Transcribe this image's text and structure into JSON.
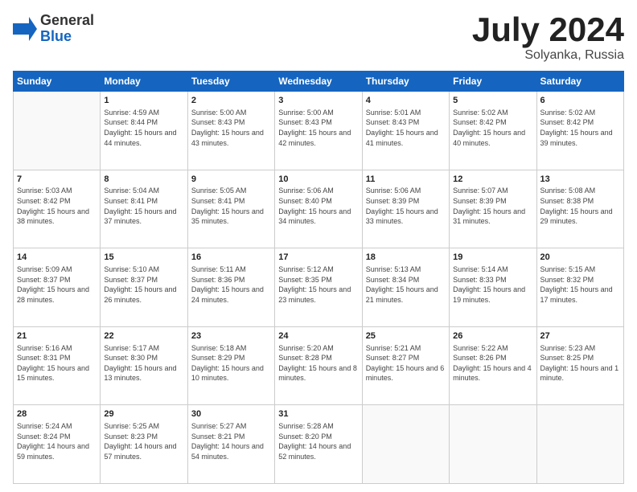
{
  "logo": {
    "general": "General",
    "blue": "Blue"
  },
  "title": {
    "month_year": "July 2024",
    "location": "Solyanka, Russia"
  },
  "weekdays": [
    "Sunday",
    "Monday",
    "Tuesday",
    "Wednesday",
    "Thursday",
    "Friday",
    "Saturday"
  ],
  "weeks": [
    [
      {
        "day": "",
        "sunrise": "",
        "sunset": "",
        "daylight": ""
      },
      {
        "day": "1",
        "sunrise": "Sunrise: 4:59 AM",
        "sunset": "Sunset: 8:44 PM",
        "daylight": "Daylight: 15 hours and 44 minutes."
      },
      {
        "day": "2",
        "sunrise": "Sunrise: 5:00 AM",
        "sunset": "Sunset: 8:43 PM",
        "daylight": "Daylight: 15 hours and 43 minutes."
      },
      {
        "day": "3",
        "sunrise": "Sunrise: 5:00 AM",
        "sunset": "Sunset: 8:43 PM",
        "daylight": "Daylight: 15 hours and 42 minutes."
      },
      {
        "day": "4",
        "sunrise": "Sunrise: 5:01 AM",
        "sunset": "Sunset: 8:43 PM",
        "daylight": "Daylight: 15 hours and 41 minutes."
      },
      {
        "day": "5",
        "sunrise": "Sunrise: 5:02 AM",
        "sunset": "Sunset: 8:42 PM",
        "daylight": "Daylight: 15 hours and 40 minutes."
      },
      {
        "day": "6",
        "sunrise": "Sunrise: 5:02 AM",
        "sunset": "Sunset: 8:42 PM",
        "daylight": "Daylight: 15 hours and 39 minutes."
      }
    ],
    [
      {
        "day": "7",
        "sunrise": "Sunrise: 5:03 AM",
        "sunset": "Sunset: 8:42 PM",
        "daylight": "Daylight: 15 hours and 38 minutes."
      },
      {
        "day": "8",
        "sunrise": "Sunrise: 5:04 AM",
        "sunset": "Sunset: 8:41 PM",
        "daylight": "Daylight: 15 hours and 37 minutes."
      },
      {
        "day": "9",
        "sunrise": "Sunrise: 5:05 AM",
        "sunset": "Sunset: 8:41 PM",
        "daylight": "Daylight: 15 hours and 35 minutes."
      },
      {
        "day": "10",
        "sunrise": "Sunrise: 5:06 AM",
        "sunset": "Sunset: 8:40 PM",
        "daylight": "Daylight: 15 hours and 34 minutes."
      },
      {
        "day": "11",
        "sunrise": "Sunrise: 5:06 AM",
        "sunset": "Sunset: 8:39 PM",
        "daylight": "Daylight: 15 hours and 33 minutes."
      },
      {
        "day": "12",
        "sunrise": "Sunrise: 5:07 AM",
        "sunset": "Sunset: 8:39 PM",
        "daylight": "Daylight: 15 hours and 31 minutes."
      },
      {
        "day": "13",
        "sunrise": "Sunrise: 5:08 AM",
        "sunset": "Sunset: 8:38 PM",
        "daylight": "Daylight: 15 hours and 29 minutes."
      }
    ],
    [
      {
        "day": "14",
        "sunrise": "Sunrise: 5:09 AM",
        "sunset": "Sunset: 8:37 PM",
        "daylight": "Daylight: 15 hours and 28 minutes."
      },
      {
        "day": "15",
        "sunrise": "Sunrise: 5:10 AM",
        "sunset": "Sunset: 8:37 PM",
        "daylight": "Daylight: 15 hours and 26 minutes."
      },
      {
        "day": "16",
        "sunrise": "Sunrise: 5:11 AM",
        "sunset": "Sunset: 8:36 PM",
        "daylight": "Daylight: 15 hours and 24 minutes."
      },
      {
        "day": "17",
        "sunrise": "Sunrise: 5:12 AM",
        "sunset": "Sunset: 8:35 PM",
        "daylight": "Daylight: 15 hours and 23 minutes."
      },
      {
        "day": "18",
        "sunrise": "Sunrise: 5:13 AM",
        "sunset": "Sunset: 8:34 PM",
        "daylight": "Daylight: 15 hours and 21 minutes."
      },
      {
        "day": "19",
        "sunrise": "Sunrise: 5:14 AM",
        "sunset": "Sunset: 8:33 PM",
        "daylight": "Daylight: 15 hours and 19 minutes."
      },
      {
        "day": "20",
        "sunrise": "Sunrise: 5:15 AM",
        "sunset": "Sunset: 8:32 PM",
        "daylight": "Daylight: 15 hours and 17 minutes."
      }
    ],
    [
      {
        "day": "21",
        "sunrise": "Sunrise: 5:16 AM",
        "sunset": "Sunset: 8:31 PM",
        "daylight": "Daylight: 15 hours and 15 minutes."
      },
      {
        "day": "22",
        "sunrise": "Sunrise: 5:17 AM",
        "sunset": "Sunset: 8:30 PM",
        "daylight": "Daylight: 15 hours and 13 minutes."
      },
      {
        "day": "23",
        "sunrise": "Sunrise: 5:18 AM",
        "sunset": "Sunset: 8:29 PM",
        "daylight": "Daylight: 15 hours and 10 minutes."
      },
      {
        "day": "24",
        "sunrise": "Sunrise: 5:20 AM",
        "sunset": "Sunset: 8:28 PM",
        "daylight": "Daylight: 15 hours and 8 minutes."
      },
      {
        "day": "25",
        "sunrise": "Sunrise: 5:21 AM",
        "sunset": "Sunset: 8:27 PM",
        "daylight": "Daylight: 15 hours and 6 minutes."
      },
      {
        "day": "26",
        "sunrise": "Sunrise: 5:22 AM",
        "sunset": "Sunset: 8:26 PM",
        "daylight": "Daylight: 15 hours and 4 minutes."
      },
      {
        "day": "27",
        "sunrise": "Sunrise: 5:23 AM",
        "sunset": "Sunset: 8:25 PM",
        "daylight": "Daylight: 15 hours and 1 minute."
      }
    ],
    [
      {
        "day": "28",
        "sunrise": "Sunrise: 5:24 AM",
        "sunset": "Sunset: 8:24 PM",
        "daylight": "Daylight: 14 hours and 59 minutes."
      },
      {
        "day": "29",
        "sunrise": "Sunrise: 5:25 AM",
        "sunset": "Sunset: 8:23 PM",
        "daylight": "Daylight: 14 hours and 57 minutes."
      },
      {
        "day": "30",
        "sunrise": "Sunrise: 5:27 AM",
        "sunset": "Sunset: 8:21 PM",
        "daylight": "Daylight: 14 hours and 54 minutes."
      },
      {
        "day": "31",
        "sunrise": "Sunrise: 5:28 AM",
        "sunset": "Sunset: 8:20 PM",
        "daylight": "Daylight: 14 hours and 52 minutes."
      },
      {
        "day": "",
        "sunrise": "",
        "sunset": "",
        "daylight": ""
      },
      {
        "day": "",
        "sunrise": "",
        "sunset": "",
        "daylight": ""
      },
      {
        "day": "",
        "sunrise": "",
        "sunset": "",
        "daylight": ""
      }
    ]
  ]
}
